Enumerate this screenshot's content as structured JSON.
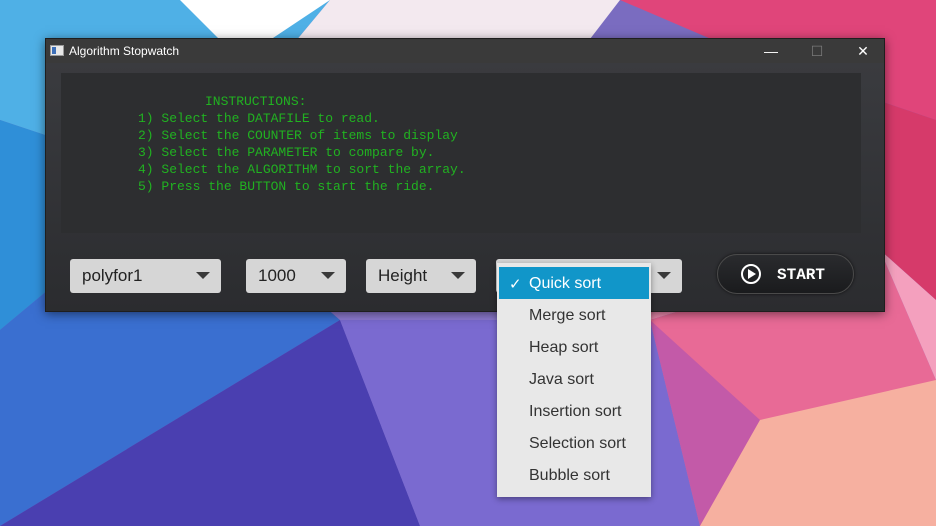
{
  "window": {
    "title": "Algorithm Stopwatch",
    "controls": {
      "minimize": "—",
      "maximize": "☐",
      "close": "✕"
    }
  },
  "instructions": {
    "heading": "INSTRUCTIONS:",
    "lines": [
      "1) Select the DATAFILE to read.",
      "2) Select the COUNTER of items to display",
      "3) Select the PARAMETER to compare by.",
      "4) Select the ALGORITHM to sort the array.",
      "5) Press the BUTTON to start the ride."
    ]
  },
  "controls": {
    "datafile": "polyfor1",
    "counter": "1000",
    "parameter": "Height",
    "algorithm": "Quick sort",
    "start_label": "START"
  },
  "dropdown": {
    "check": "✓",
    "items": [
      "Quick sort",
      "Merge sort",
      "Heap sort",
      "Java sort",
      "Insertion sort",
      "Selection sort",
      "Bubble sort"
    ],
    "selected_index": 0
  },
  "colors": {
    "instruction_text": "#21b221",
    "selection": "#1196c9"
  }
}
